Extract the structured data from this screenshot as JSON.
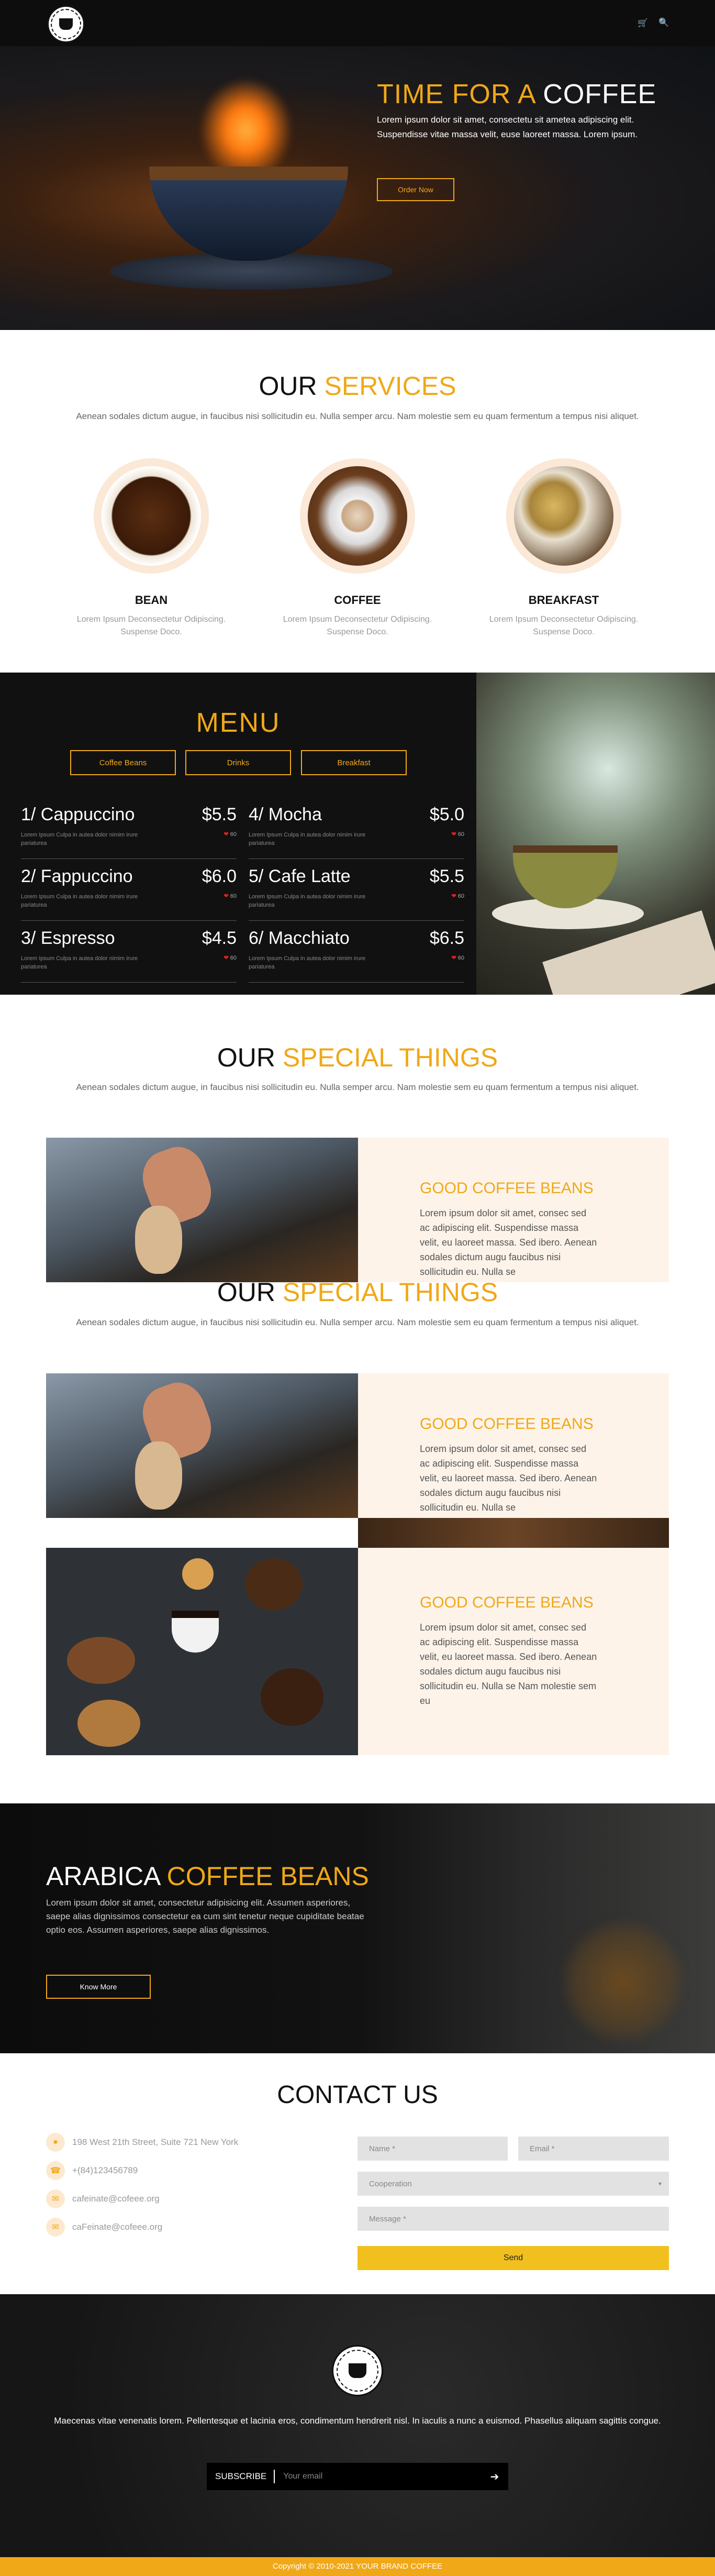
{
  "header": {
    "logo_alt": "CAFFEINATE COFFEE",
    "cart_icon": "cart-icon",
    "search_icon": "search-icon"
  },
  "hero": {
    "title_accent": "TIME FOR A",
    "title_main": "COFFEE",
    "text": "Lorem ipsum dolor sit amet, consectetu sit ametea adipiscing elit. Suspendisse vitae massa velit, euse laoreet massa. Lorem ipsum.",
    "button": "Order Now"
  },
  "services": {
    "title_main": "OUR",
    "title_accent": "SERVICES",
    "subtitle": "Aenean sodales dictum augue, in faucibus nisi sollicitudin eu. Nulla semper arcu. Nam molestie sem eu quam fermentum a tempus nisi aliquet.",
    "items": [
      {
        "name": "BEAN",
        "text": "Lorem Ipsum Deconsectetur Odipiscing. Suspense Doco."
      },
      {
        "name": "COFFEE",
        "text": "Lorem Ipsum Deconsectetur Odipiscing. Suspense Doco."
      },
      {
        "name": "BREAKFAST",
        "text": "Lorem Ipsum Deconsectetur Odipiscing. Suspense Doco."
      }
    ]
  },
  "menu": {
    "title": "MENU",
    "tabs": [
      "Coffee Beans",
      "Drinks",
      "Breakfast"
    ],
    "items": [
      {
        "name": "1/ Cappuccino",
        "price": "$5.5",
        "desc": "Lorem Ipsum Culpa in autea dolor nimim irure pariaturea",
        "likes": "60"
      },
      {
        "name": "4/ Mocha",
        "price": "$5.0",
        "desc": "Lorem Ipsum Culpa in autea dolor nimim irure pariaturea",
        "likes": "60"
      },
      {
        "name": "2/ Fappuccino",
        "price": "$6.0",
        "desc": "Lorem Ipsum Culpa in autea dolor nimim irure pariaturea",
        "likes": "60"
      },
      {
        "name": "5/ Cafe Latte",
        "price": "$5.5",
        "desc": "Lorem Ipsum Culpa in autea dolor nimim irure pariaturea",
        "likes": "60"
      },
      {
        "name": "3/ Espresso",
        "price": "$4.5",
        "desc": "Lorem Ipsum Culpa in autea dolor nimim irure pariaturea",
        "likes": "60"
      },
      {
        "name": "6/ Macchiato",
        "price": "$6.5",
        "desc": "Lorem Ipsum Culpa in autea dolor nimim irure pariaturea",
        "likes": "60"
      }
    ]
  },
  "special1": {
    "title_main": "OUR",
    "title_accent": "SPECIAL THINGS",
    "subtitle": "Aenean sodales dictum augue, in faucibus nisi sollicitudin eu. Nulla semper arcu. Nam molestie sem eu quam fermentum a tempus nisi aliquet.",
    "box_title": "GOOD COFFEE BEANS",
    "box_text": "Lorem ipsum dolor sit amet, consec sed ac adipiscing elit. Suspendisse massa velit, eu laoreet massa. Sed ibero. Aenean sodales dictum augu faucibus nisi sollicitudin eu. Nulla se"
  },
  "special2": {
    "title_main": "OUR",
    "title_accent": "SPECIAL THINGS",
    "subtitle": "Aenean sodales dictum augue, in faucibus nisi sollicitudin eu. Nulla semper arcu. Nam molestie sem eu quam fermentum a tempus nisi aliquet.",
    "box1_title": "GOOD COFFEE BEANS",
    "box1_text": "Lorem ipsum dolor sit amet, consec sed ac adipiscing elit. Suspendisse massa velit, eu laoreet massa. Sed ibero. Aenean sodales dictum augu faucibus nisi sollicitudin eu. Nulla se",
    "box2_title": "GOOD COFFEE BEANS",
    "box2_text": "Lorem ipsum dolor sit amet, consec sed ac adipiscing elit. Suspendisse massa velit, eu laoreet massa. Sed ibero. Aenean sodales dictum augu faucibus nisi sollicitudin eu. Nulla se Nam molestie sem eu"
  },
  "arabica": {
    "title_main": "ARABICA",
    "title_accent": "COFFEE BEANS",
    "text": "Lorem ipsum dolor sit amet, consectetur adipisicing elit. Assumen asperiores, saepe alias dignissimos consectetur ea cum sint tenetur neque cupiditate beatae optio eos. Assumen asperiores, saepe alias dignissimos.",
    "button": "Know More"
  },
  "contact": {
    "title": "CONTACT US",
    "info": [
      {
        "icon": "location-icon",
        "text": "198 West 21th Street, Suite 721 New York"
      },
      {
        "icon": "phone-icon",
        "text": "+(84)123456789"
      },
      {
        "icon": "email-icon",
        "text": "cafeinate@cofeee.org"
      },
      {
        "icon": "email-icon",
        "text": "caFeinate@cofeee.org"
      }
    ],
    "name_placeholder": "Name *",
    "email_placeholder": "Email *",
    "select_value": "Cooperation",
    "message_placeholder": "Message *",
    "send": "Send"
  },
  "footer": {
    "text": "Maecenas vitae venenatis lorem. Pellentesque et lacinia eros, condimentum hendrerit nisl. In iaculis a nunc a euismod. Phasellus aliquam sagittis congue.",
    "subscribe_label": "SUBSCRIBE",
    "email_placeholder": "Your email",
    "copyright": "Copyright © 2010-2021 YOUR BRAND COFFEE"
  },
  "colors": {
    "accent": "#f0a818",
    "dark": "#111111",
    "cream": "#fdf3e9",
    "send": "#f2c01e"
  }
}
